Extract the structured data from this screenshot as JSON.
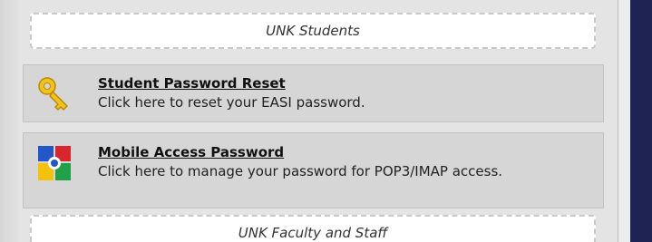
{
  "sections": {
    "students_header": "UNK Students",
    "faculty_header": "UNK Faculty and Staff"
  },
  "links": {
    "password_reset": {
      "title": "Student Password Reset",
      "description": "Click here to reset your EASI password.",
      "icon": "key-icon"
    },
    "mobile_access": {
      "title": "Mobile Access Password",
      "description": "Click here to manage your password for POP3/IMAP access.",
      "icon": "google-apps-icon"
    }
  },
  "colors": {
    "background": "#e4e4e4",
    "panel": "#d6d6d6",
    "navy": "#1e2353"
  }
}
